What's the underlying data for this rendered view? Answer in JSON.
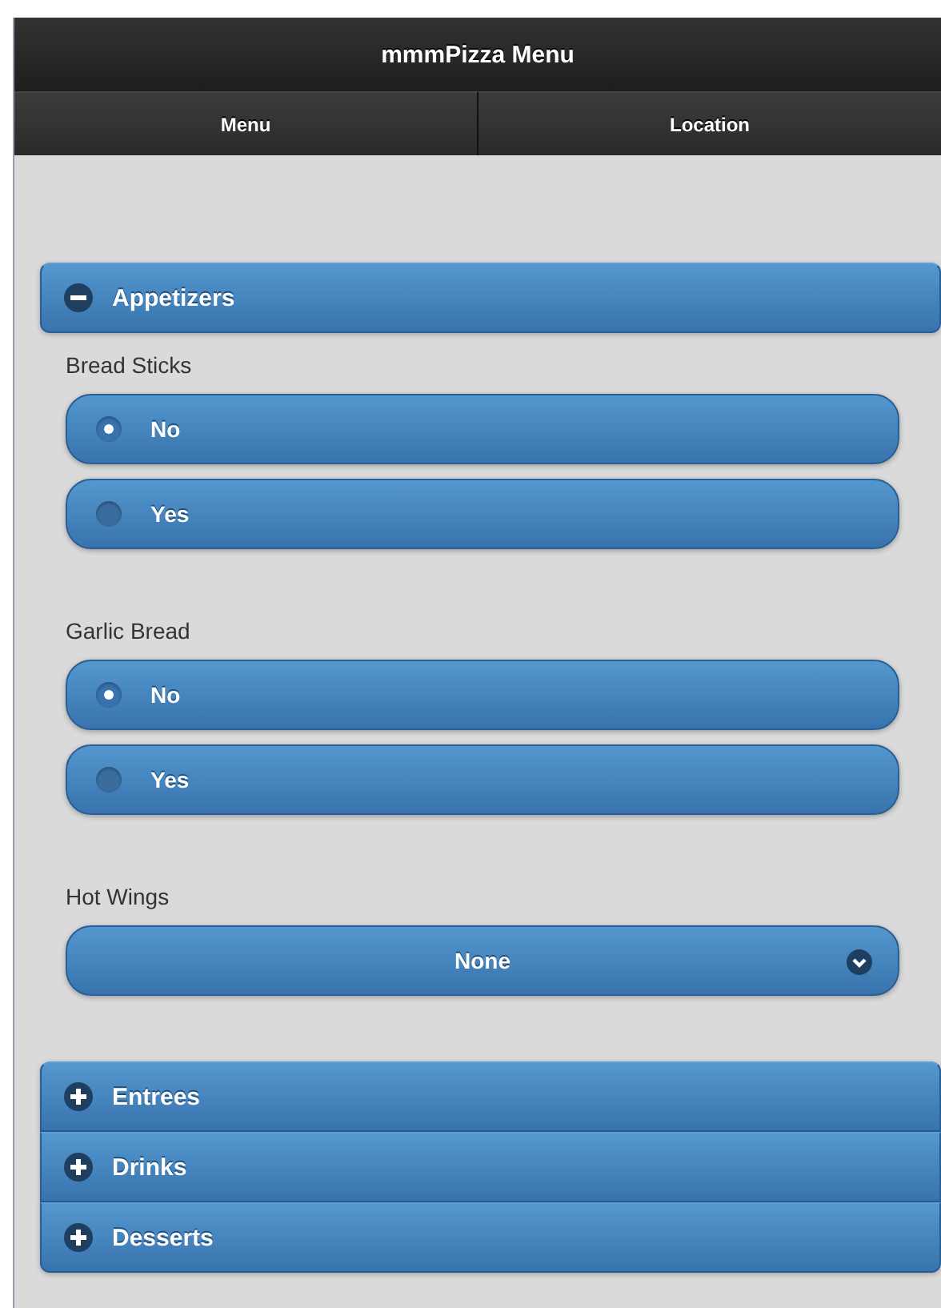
{
  "header": {
    "title": "mmmPizza Menu"
  },
  "navbar": [
    {
      "label": "Menu",
      "selected": false
    },
    {
      "label": "Location",
      "selected": false
    }
  ],
  "sections": [
    {
      "title": "Appetizers",
      "expanded": true,
      "fields": [
        {
          "kind": "radio",
          "label": "Bread Sticks",
          "options": [
            {
              "label": "No",
              "selected": true
            },
            {
              "label": "Yes",
              "selected": false
            }
          ]
        },
        {
          "kind": "radio",
          "label": "Garlic Bread",
          "options": [
            {
              "label": "No",
              "selected": true
            },
            {
              "label": "Yes",
              "selected": false
            }
          ]
        },
        {
          "kind": "select",
          "label": "Hot Wings",
          "value": "None"
        }
      ]
    },
    {
      "title": "Entrees",
      "expanded": false
    },
    {
      "title": "Drinks",
      "expanded": false
    },
    {
      "title": "Desserts",
      "expanded": false
    }
  ]
}
